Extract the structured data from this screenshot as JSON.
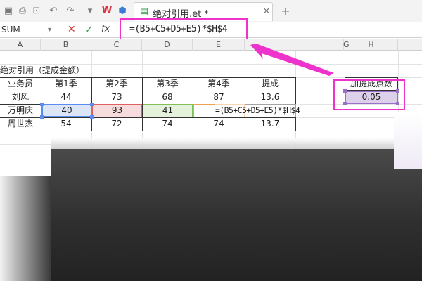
{
  "tab": {
    "title": "绝对引用.et *"
  },
  "formula_bar": {
    "name_box": "SUM",
    "cancel_glyph": "✕",
    "accept_glyph": "✓",
    "fx_label": "fx",
    "formula": "=(B5+C5+D5+E5)*$H$4"
  },
  "columns": [
    "A",
    "B",
    "C",
    "D",
    "E",
    "G",
    "H"
  ],
  "sheet": {
    "title": "绝对引用（提成金额）",
    "header": [
      "业务员",
      "第1季",
      "第2季",
      "第3季",
      "第4季",
      "提成"
    ],
    "rows": [
      [
        "刘风",
        "44",
        "73",
        "68",
        "87",
        "13.6"
      ],
      [
        "万明庆",
        "40",
        "93",
        "41",
        "",
        ""
      ],
      [
        "周世杰",
        "54",
        "72",
        "74",
        "74",
        "13.7"
      ]
    ],
    "editing_formula": "=(B5+C5+D5+E5)*$H$4",
    "rate_label": "加提成点数",
    "rate_value": "0.05"
  },
  "colors": {
    "accent_pink": "#ee33cc",
    "ref_blue": "#5b8def",
    "ref_red": "#e06060",
    "ref_green": "#7fbf5a",
    "ref_orange": "#f0a050",
    "ref_purple": "#9a6fc8"
  },
  "icons": [
    "save-icon",
    "print-icon",
    "preview-icon",
    "undo-icon",
    "redo-icon",
    "dropdown-icon",
    "wps-logo-icon",
    "cloud-cube-icon",
    "sheet-file-icon",
    "tab-close-icon",
    "new-tab-icon"
  ]
}
